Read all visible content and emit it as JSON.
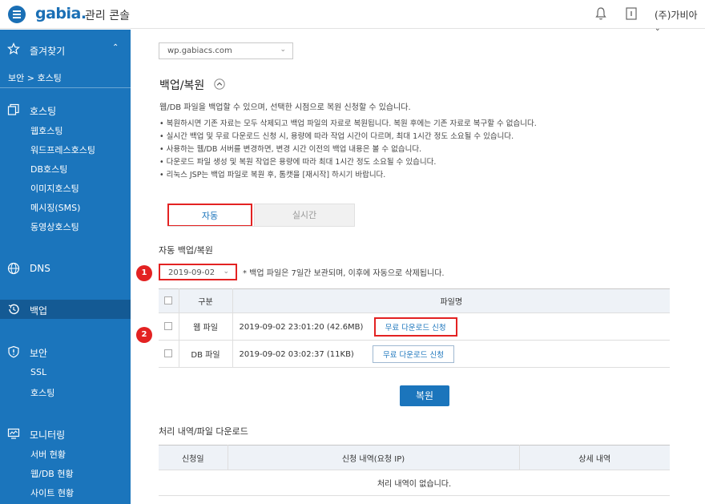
{
  "header": {
    "logo": "gabia.",
    "console_title": "관리 콘솔",
    "user_name": "(주)가비아"
  },
  "sidebar": {
    "favorites_label": "즐겨찾기",
    "breadcrumb": "보안 > 호스팅",
    "groups": [
      {
        "title": "호스팅",
        "icon": "copy-icon",
        "items": [
          "웹호스팅",
          "워드프레스호스팅",
          "DB호스팅",
          "이미지호스팅",
          "메시징(SMS)",
          "동영상호스팅"
        ]
      },
      {
        "title": "DNS",
        "icon": "globe-icon",
        "items": []
      },
      {
        "title": "백업",
        "icon": "history-icon",
        "items": []
      },
      {
        "title": "보안",
        "icon": "shield-icon",
        "items": [
          "SSL",
          "호스팅"
        ]
      },
      {
        "title": "모니터링",
        "icon": "monitor-icon",
        "items": [
          "서버 현황",
          "웹/DB 현황",
          "사이트 현황"
        ]
      }
    ]
  },
  "main": {
    "site_select_value": "wp.gabiacs.com",
    "section_title": "백업/복원",
    "description": "웹/DB 파일을 백업할 수 있으며, 선택한 시점으로 복원 신청할 수 있습니다.",
    "bullets": [
      "복원하시면 기존 자료는 모두 삭제되고 백업 파일의 자료로 복원됩니다. 복원 후에는 기존 자료로 복구할 수 없습니다.",
      "실시간 백업 및 무료 다운로드 신청 시, 용량에 따라 작업 시간이 다르며, 최대 1시간 정도 소요될 수 있습니다.",
      "사용하는 웹/DB 서버를 변경하면, 변경 시간 이전의 백업 내용은 볼 수 없습니다.",
      "다운로드 파일 생성 및 복원 작업은 용량에 따라 최대 1시간 정도 소요될 수 있습니다.",
      "리눅스 JSP는 백업 파일로 복원 후, 톰캣을 [재시작] 하시기 바랍니다."
    ],
    "tabs": [
      "자동",
      "실시간"
    ],
    "auto_heading": "자동 백업/복원",
    "date_value": "2019-09-02",
    "date_note": "* 백업 파일은 7일간 보관되며, 이후에 자동으로 삭제됩니다.",
    "badges": [
      "1",
      "2"
    ],
    "backup_table": {
      "headers": [
        "구분",
        "파일명"
      ],
      "rows": [
        {
          "type": "웹 파일",
          "file": "2019-09-02 23:01:20 (42.6MB)",
          "button": "무료 다운로드 신청"
        },
        {
          "type": "DB 파일",
          "file": "2019-09-02 03:02:37 (11KB)",
          "button": "무료 다운로드 신청"
        }
      ]
    },
    "restore_button": "복원",
    "history_title": "처리 내역/파일 다운로드",
    "history_table": {
      "headers": [
        "신청일",
        "신청 내역(요청 IP)",
        "상세 내역"
      ],
      "empty_text": "처리 내역이 없습니다."
    }
  },
  "colors": {
    "brand": "#1b75bc",
    "highlight": "#e32222"
  }
}
